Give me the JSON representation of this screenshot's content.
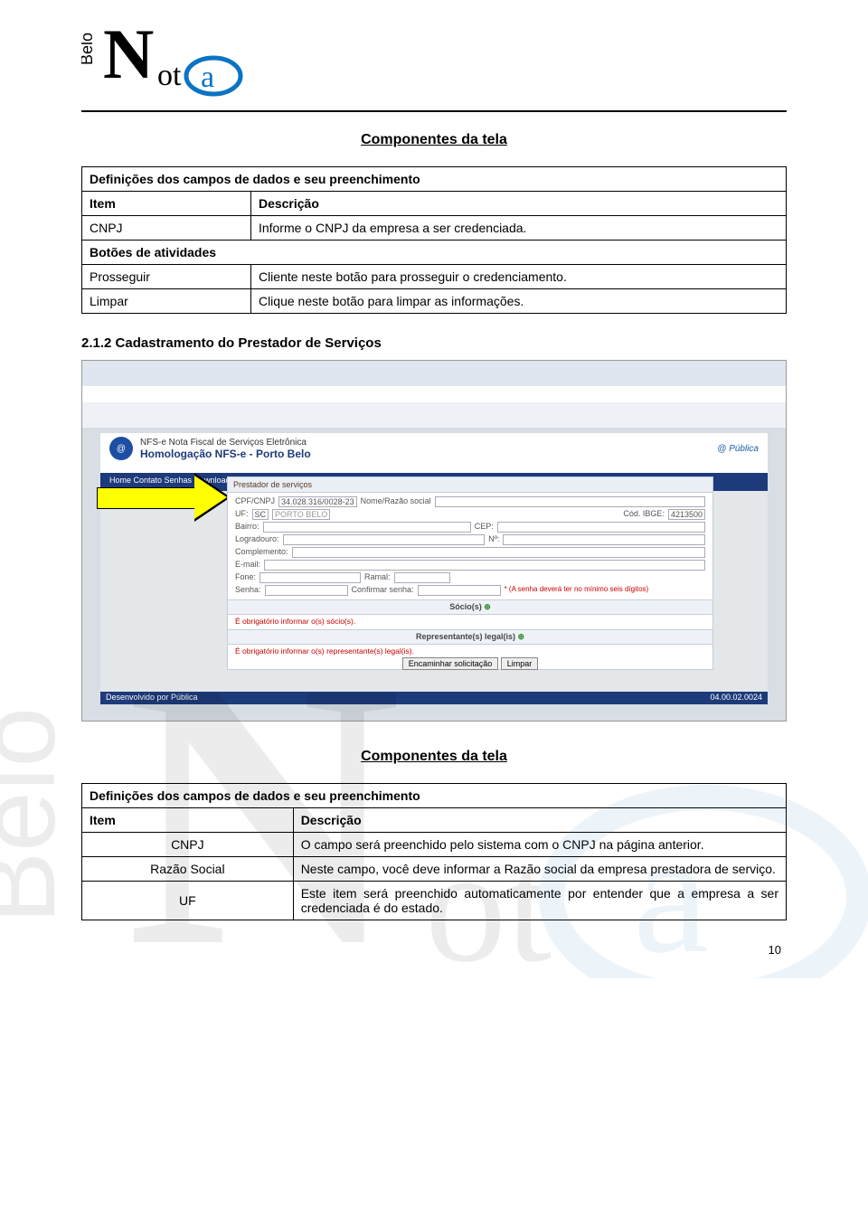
{
  "logo_text": "BeloNot@",
  "section1": {
    "title": "Componentes da tela",
    "sub1": "Definições dos campos de dados e seu preenchimento",
    "h_item": "Item",
    "h_desc": "Descrição",
    "r1_item": "CNPJ",
    "r1_desc": "Informe o CNPJ da empresa a ser credenciada.",
    "sub2": "Botões de atividades",
    "r2_item": "Prosseguir",
    "r2_desc": "Cliente neste botão para prosseguir o credenciamento.",
    "r3_item": "Limpar",
    "r3_desc": "Clique neste botão para limpar as informações."
  },
  "heading212": "2.1.2 Cadastramento do Prestador de Serviços",
  "screenshot": {
    "appbar_title": "NFS-e Nota Fiscal de Serviços Eletrônica",
    "appbar_subtitle": "Homologação NFS-e - Porto Belo",
    "nav": "Home   Contato   Senhas   Downloads   Perguntas frequentes",
    "panel_title": "Prestador de serviços",
    "lbl_cpfcnpj": "CPF/CNPJ",
    "val_cpfcnpj": "34.028.316/0028-23",
    "lbl_nome": "Nome/Razão social",
    "lbl_uf": "UF:",
    "val_uf": "SC",
    "val_city": "PORTO BELO",
    "lbl_ibge": "Cód. IBGE:",
    "val_ibge": "4213500",
    "lbl_bairro": "Bairro:",
    "lbl_cep": "CEP:",
    "lbl_log": "Logradouro:",
    "lbl_num": "Nº:",
    "lbl_comp": "Complemento:",
    "lbl_email": "E-mail:",
    "lbl_fone": "Fone:",
    "lbl_ramal": "Ramal:",
    "lbl_senha": "Senha:",
    "lbl_confirmar": "Confirmar senha:",
    "senha_hint": "* (A senha deverá ter no mínimo seis dígitos)",
    "socios_hdr": "Sócio(s)",
    "err_socios": "É obrigatório informar o(s) sócio(s).",
    "rep_hdr": "Representante(s) legal(is)",
    "err_rep": "É obrigatório informar o(s) representante(s) legal(is).",
    "btn_encaminhar": "Encaminhar solicitação",
    "btn_limpar": "Limpar",
    "footer_left": "Desenvolvido por Pública",
    "footer_right": "04.00.02.0024"
  },
  "section2": {
    "title": "Componentes da tela",
    "sub1": "Definições dos campos de dados e seu preenchimento",
    "h_item": "Item",
    "h_desc": "Descrição",
    "r1_item": "CNPJ",
    "r1_desc": "O campo será preenchido pelo sistema com o CNPJ na página anterior.",
    "r2_item": "Razão Social",
    "r2_desc": "Neste campo, você deve informar a Razão social da empresa prestadora de serviço.",
    "r3_item": "UF",
    "r3_desc": "Este item será preenchido automaticamente por entender que a empresa a ser credenciada é do estado."
  },
  "page_number": "10"
}
